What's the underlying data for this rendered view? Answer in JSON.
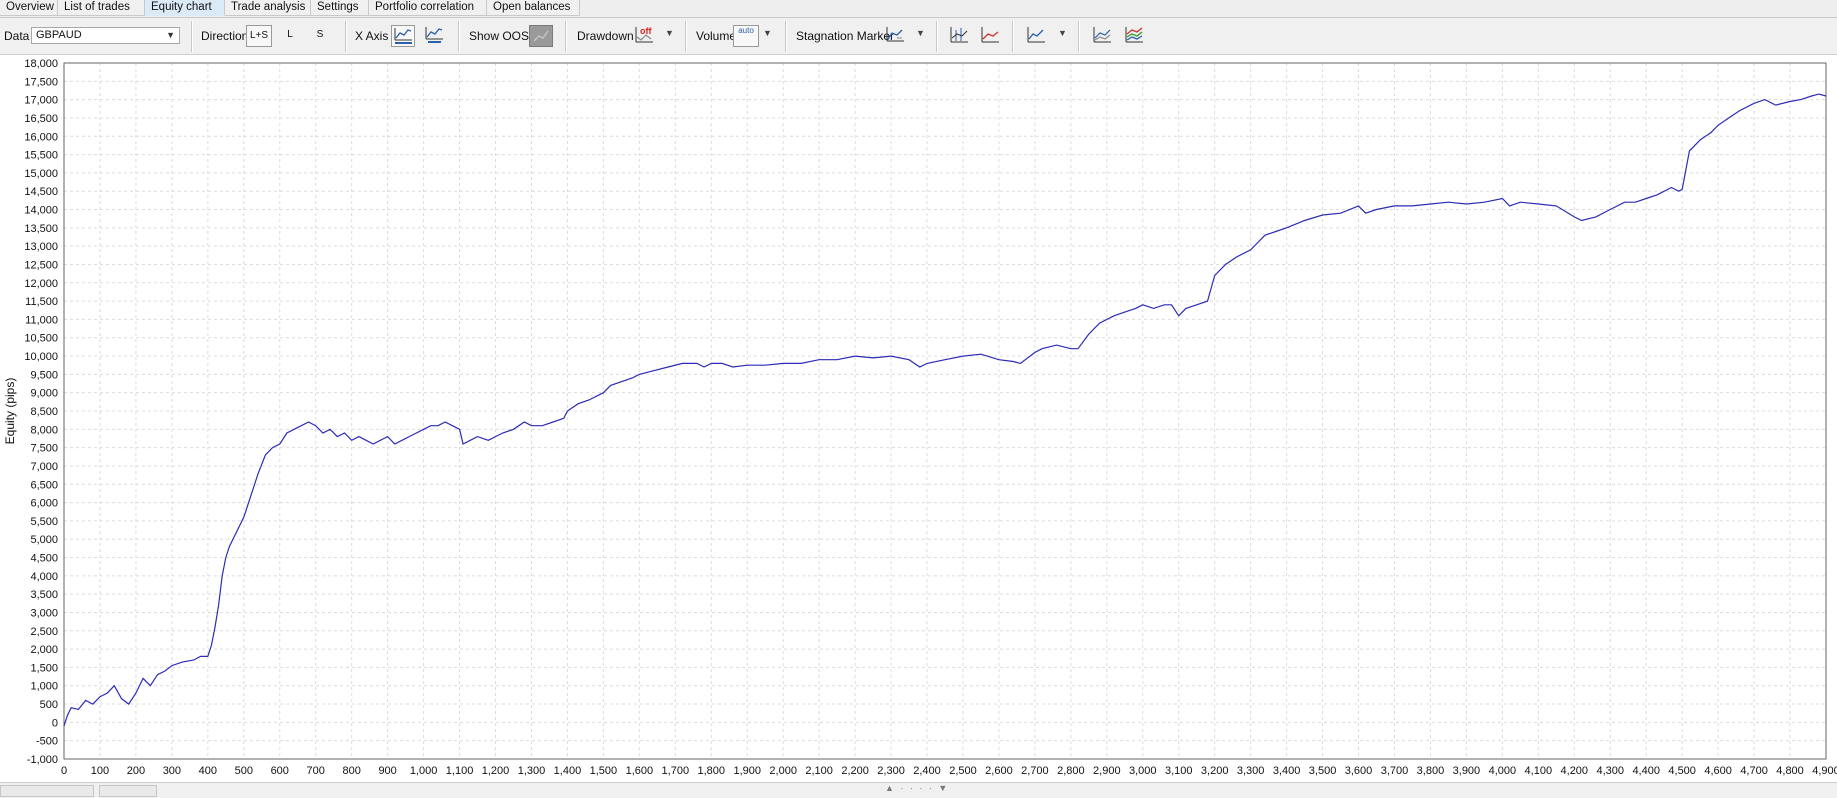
{
  "tabs": [
    {
      "label": "Overview",
      "active": false
    },
    {
      "label": "List of trades",
      "active": false
    },
    {
      "label": "Equity chart",
      "active": true
    },
    {
      "label": "Trade analysis",
      "active": false
    },
    {
      "label": "Settings",
      "active": false
    },
    {
      "label": "Portfolio correlation",
      "active": false
    },
    {
      "label": "Open balances",
      "active": false
    }
  ],
  "toolbar": {
    "data_label": "Data",
    "data_value": "GBPAUD",
    "direction_label": "Direction",
    "direction_options": [
      "L+S",
      "L",
      "S"
    ],
    "direction_selected": "L+S",
    "xaxis_label": "X Axis",
    "xaxis_options": [
      "trades",
      "time"
    ],
    "xaxis_selected": "trades",
    "show_oos_label": "Show OOS",
    "drawdown_label": "Drawdown",
    "drawdown_state": "off",
    "volume_label": "Volume",
    "volume_state": "auto",
    "stagnation_label": "Stagnation Marker"
  },
  "chart_data": {
    "type": "line",
    "ylabel": "Equity (pips)",
    "xlabel": "",
    "xlim": [
      0,
      4900
    ],
    "ylim": [
      -1000,
      18000
    ],
    "x_ticks": [
      0,
      100,
      200,
      300,
      400,
      500,
      600,
      700,
      800,
      900,
      1000,
      1100,
      1200,
      1300,
      1400,
      1500,
      1600,
      1700,
      1800,
      1900,
      2000,
      2100,
      2200,
      2300,
      2400,
      2500,
      2600,
      2700,
      2800,
      2900,
      3000,
      3100,
      3200,
      3300,
      3400,
      3500,
      3600,
      3700,
      3800,
      3900,
      4000,
      4100,
      4200,
      4300,
      4400,
      4500,
      4600,
      4700,
      4800,
      4900
    ],
    "x_tick_labels": [
      "0",
      "100",
      "200",
      "300",
      "400",
      "500",
      "600",
      "700",
      "800",
      "900",
      "1,000",
      "1,100",
      "1,200",
      "1,300",
      "1,400",
      "1,500",
      "1,600",
      "1,700",
      "1,800",
      "1,900",
      "2,000",
      "2,100",
      "2,200",
      "2,300",
      "2,400",
      "2,500",
      "2,600",
      "2,700",
      "2,800",
      "2,900",
      "3,000",
      "3,100",
      "3,200",
      "3,300",
      "3,400",
      "3,500",
      "3,600",
      "3,700",
      "3,800",
      "3,900",
      "4,000",
      "4,100",
      "4,200",
      "4,300",
      "4,400",
      "4,500",
      "4,600",
      "4,700",
      "4,800",
      "4,900"
    ],
    "y_ticks": [
      -1000,
      -500,
      0,
      500,
      1000,
      1500,
      2000,
      2500,
      3000,
      3500,
      4000,
      4500,
      5000,
      5500,
      6000,
      6500,
      7000,
      7500,
      8000,
      8500,
      9000,
      9500,
      10000,
      10500,
      11000,
      11500,
      12000,
      12500,
      13000,
      13500,
      14000,
      14500,
      15000,
      15500,
      16000,
      16500,
      17000,
      17500,
      18000
    ],
    "y_tick_labels": [
      "-1,000",
      "-500",
      "0",
      "500",
      "1,000",
      "1,500",
      "2,000",
      "2,500",
      "3,000",
      "3,500",
      "4,000",
      "4,500",
      "5,000",
      "5,500",
      "6,000",
      "6,500",
      "7,000",
      "7,500",
      "8,000",
      "8,500",
      "9,000",
      "9,500",
      "10,000",
      "10,500",
      "11,000",
      "11,500",
      "12,000",
      "12,500",
      "13,000",
      "13,500",
      "14,000",
      "14,500",
      "15,000",
      "15,500",
      "16,000",
      "16,500",
      "17,000",
      "17,500",
      "18,000"
    ],
    "grid": true,
    "line_color": "#2b2bb8",
    "series": [
      {
        "x": [
          0,
          10,
          20,
          40,
          60,
          80,
          100,
          120,
          140,
          160,
          180,
          200,
          220,
          240,
          260,
          280,
          300,
          330,
          360,
          380,
          400,
          410,
          420,
          430,
          440,
          450,
          460,
          480,
          500,
          520,
          540,
          560,
          580,
          600,
          620,
          640,
          660,
          680,
          700,
          720,
          740,
          760,
          780,
          800,
          820,
          840,
          860,
          880,
          900,
          920,
          940,
          960,
          980,
          1000,
          1020,
          1040,
          1060,
          1080,
          1100,
          1110,
          1130,
          1150,
          1180,
          1200,
          1220,
          1250,
          1280,
          1300,
          1330,
          1360,
          1390,
          1400,
          1430,
          1460,
          1500,
          1520,
          1550,
          1580,
          1600,
          1640,
          1680,
          1720,
          1760,
          1780,
          1800,
          1830,
          1860,
          1900,
          1950,
          2000,
          2050,
          2100,
          2150,
          2200,
          2250,
          2300,
          2350,
          2380,
          2400,
          2450,
          2500,
          2550,
          2600,
          2640,
          2660,
          2700,
          2720,
          2760,
          2800,
          2820,
          2850,
          2880,
          2920,
          2950,
          2980,
          3000,
          3030,
          3060,
          3080,
          3100,
          3120,
          3150,
          3180,
          3200,
          3230,
          3260,
          3300,
          3320,
          3340,
          3370,
          3400,
          3450,
          3500,
          3550,
          3600,
          3620,
          3650,
          3700,
          3750,
          3800,
          3850,
          3900,
          3950,
          4000,
          4020,
          4050,
          4100,
          4150,
          4200,
          4220,
          4260,
          4300,
          4340,
          4370,
          4400,
          4430,
          4470,
          4490,
          4500,
          4520,
          4530,
          4550,
          4580,
          4600,
          4630,
          4660,
          4700,
          4730,
          4760,
          4800,
          4830,
          4860,
          4880,
          4900
        ],
        "y": [
          -100,
          200,
          400,
          350,
          600,
          500,
          700,
          800,
          1000,
          650,
          500,
          800,
          1200,
          1000,
          1300,
          1400,
          1550,
          1650,
          1700,
          1800,
          1800,
          2100,
          2600,
          3200,
          4000,
          4500,
          4800,
          5200,
          5600,
          6200,
          6800,
          7300,
          7500,
          7600,
          7900,
          8000,
          8100,
          8200,
          8100,
          7900,
          8000,
          7800,
          7900,
          7700,
          7800,
          7700,
          7600,
          7700,
          7800,
          7600,
          7700,
          7800,
          7900,
          8000,
          8100,
          8100,
          8200,
          8100,
          8000,
          7600,
          7700,
          7800,
          7700,
          7800,
          7900,
          8000,
          8200,
          8100,
          8100,
          8200,
          8300,
          8500,
          8700,
          8800,
          9000,
          9200,
          9300,
          9400,
          9500,
          9600,
          9700,
          9800,
          9800,
          9700,
          9800,
          9800,
          9700,
          9750,
          9750,
          9800,
          9800,
          9900,
          9900,
          10000,
          9950,
          10000,
          9900,
          9700,
          9800,
          9900,
          10000,
          10050,
          9900,
          9850,
          9800,
          10100,
          10200,
          10300,
          10200,
          10200,
          10600,
          10900,
          11100,
          11200,
          11300,
          11400,
          11300,
          11400,
          11400,
          11100,
          11300,
          11400,
          11500,
          12200,
          12500,
          12700,
          12900,
          13100,
          13300,
          13400,
          13500,
          13700,
          13850,
          13900,
          14100,
          13900,
          14000,
          14100,
          14100,
          14150,
          14200,
          14150,
          14200,
          14300,
          14100,
          14200,
          14150,
          14100,
          13800,
          13700,
          13800,
          14000,
          14200,
          14200,
          14300,
          14400,
          14600,
          14500,
          14550,
          15600,
          15700,
          15900,
          16100,
          16300,
          16500,
          16700,
          16900,
          17000,
          16850,
          16950,
          17000,
          17100,
          17150,
          17100
        ]
      }
    ]
  }
}
